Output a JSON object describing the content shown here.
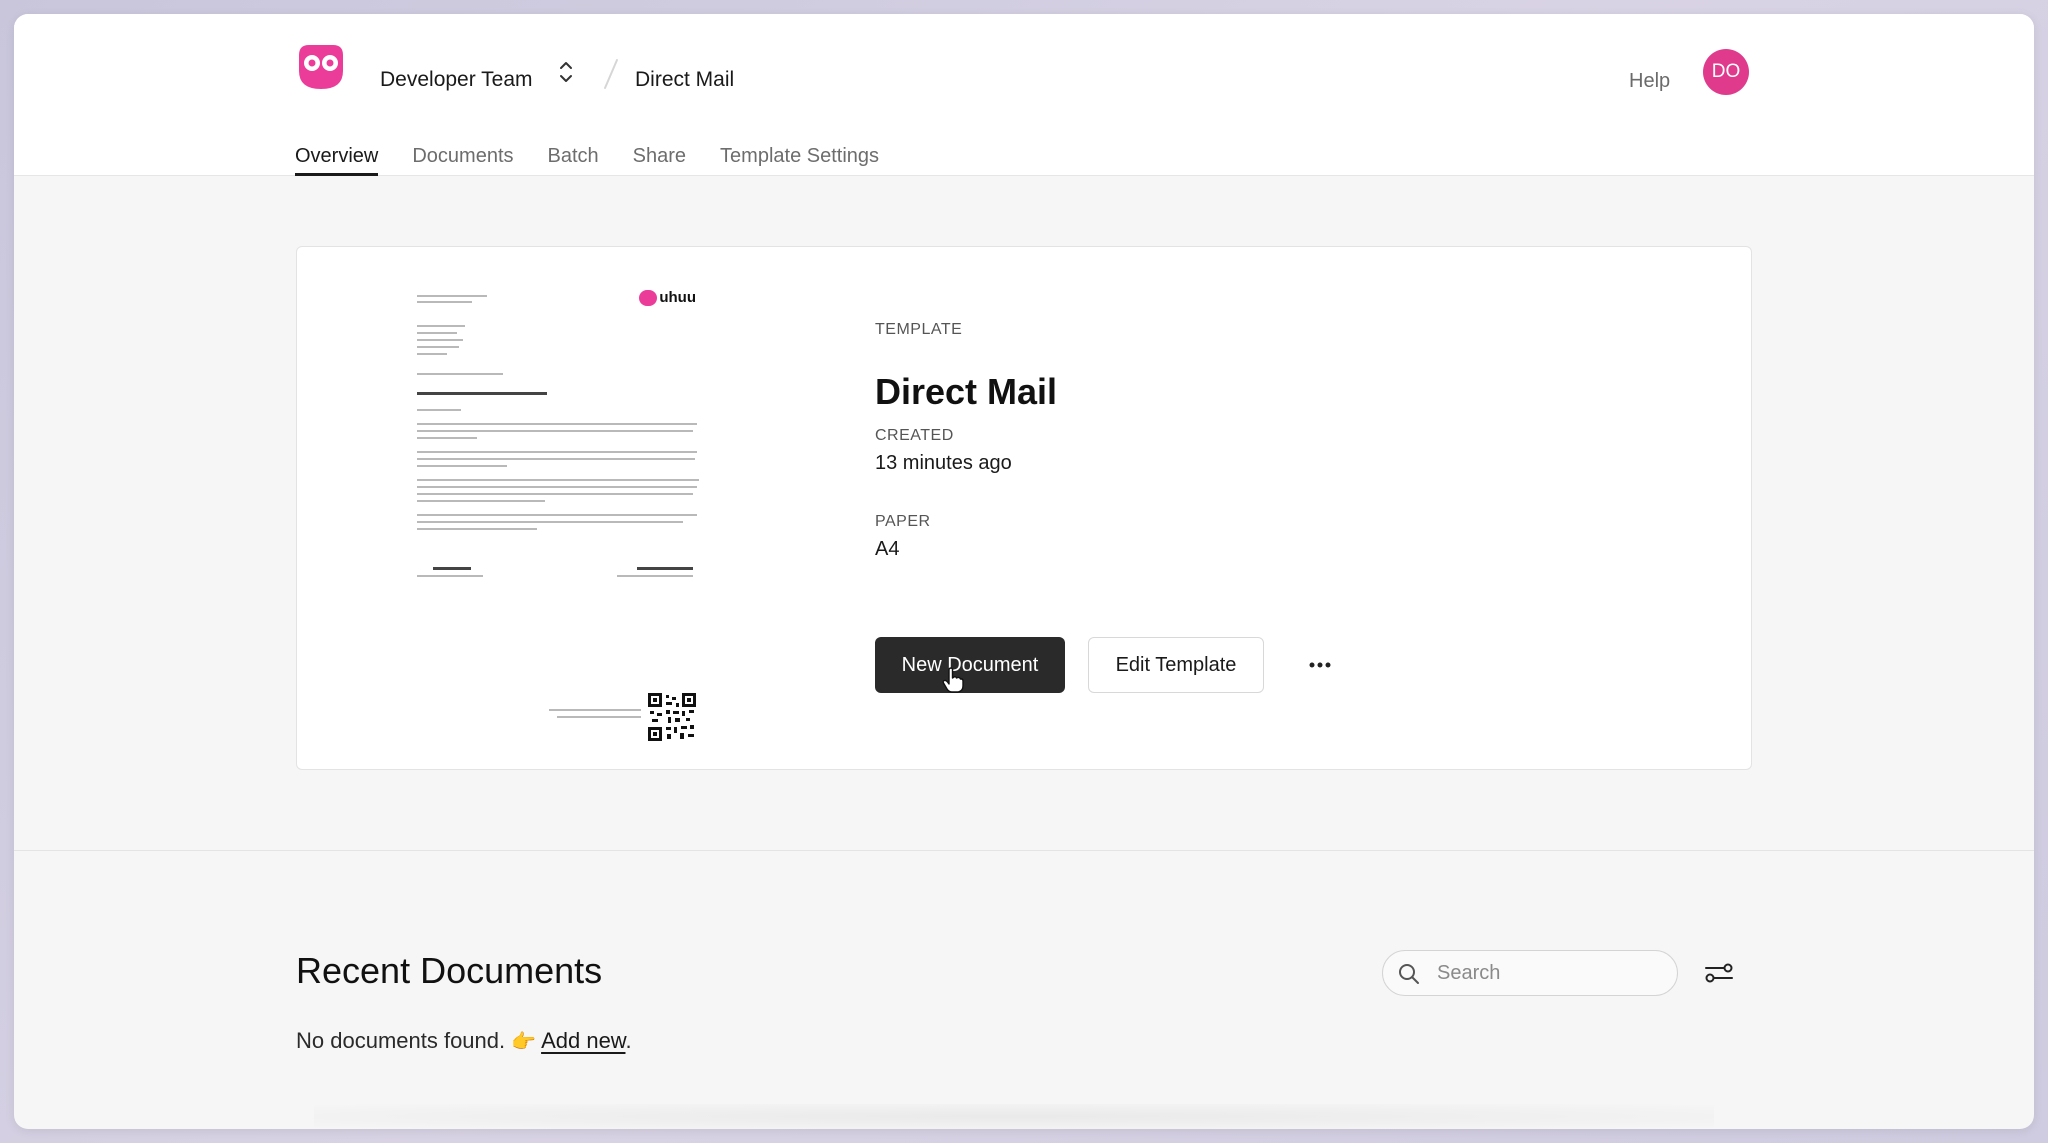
{
  "header": {
    "team_name": "Developer Team",
    "breadcrumb_page": "Direct Mail",
    "help_label": "Help",
    "avatar_initials": "DO",
    "brand_color": "#ec3c9a"
  },
  "tabs": [
    {
      "label": "Overview",
      "active": true
    },
    {
      "label": "Documents",
      "active": false
    },
    {
      "label": "Batch",
      "active": false
    },
    {
      "label": "Share",
      "active": false
    },
    {
      "label": "Template Settings",
      "active": false
    }
  ],
  "template": {
    "type_label": "TEMPLATE",
    "title": "Direct Mail",
    "created_label": "CREATED",
    "created_value": "13 minutes ago",
    "paper_label": "PAPER",
    "paper_value": "A4",
    "new_document_label": "New Document",
    "edit_template_label": "Edit Template",
    "preview": {
      "logo_text": "uhuu"
    }
  },
  "recent": {
    "title": "Recent Documents",
    "search_placeholder": "Search",
    "empty_text": "No documents found.",
    "add_new_label": "Add new",
    "trailing_period": "."
  }
}
